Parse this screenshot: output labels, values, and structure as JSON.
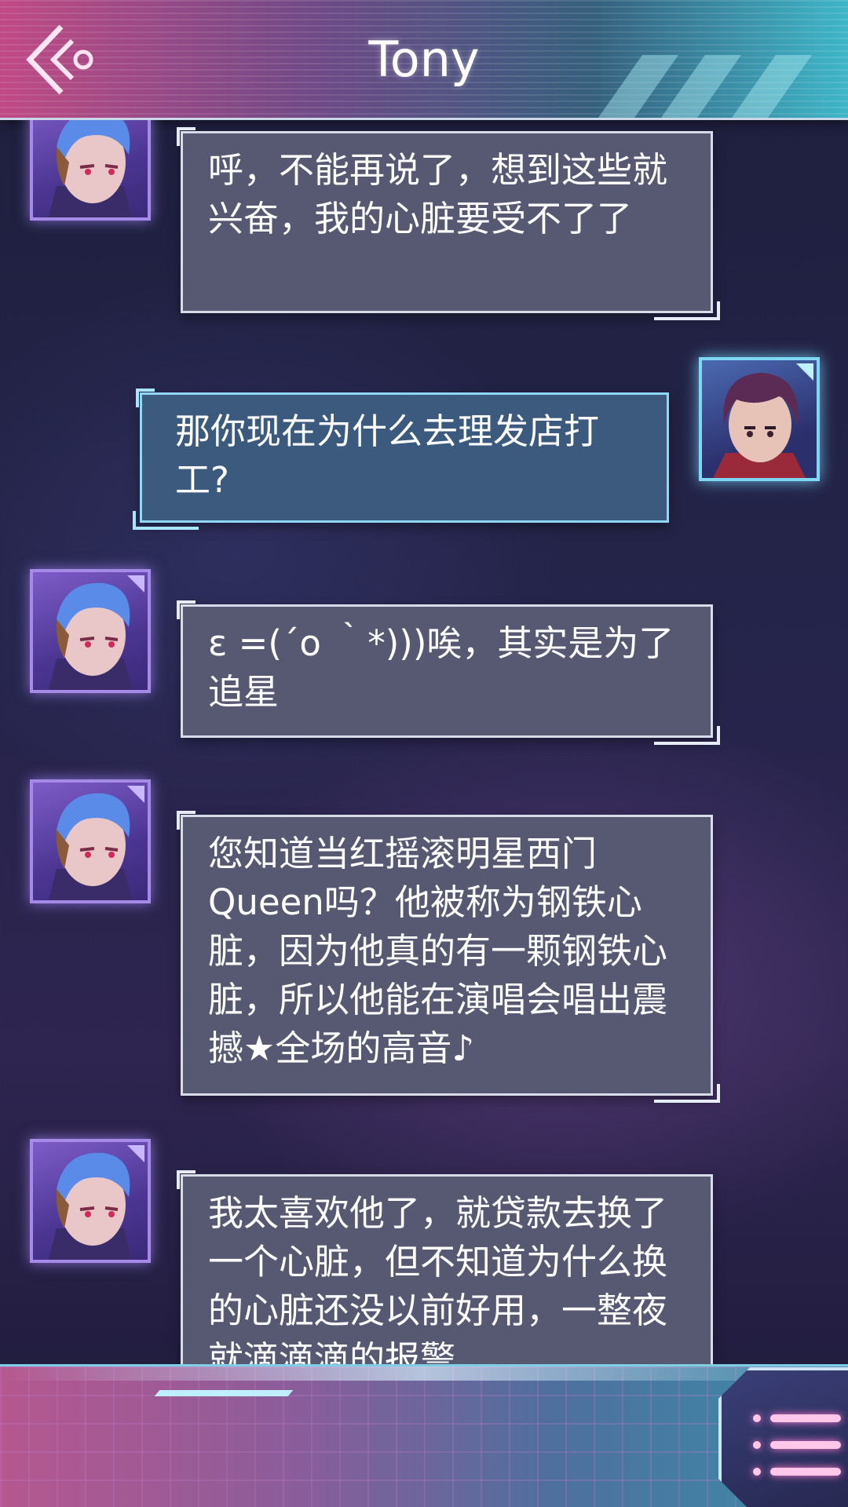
{
  "header": {
    "title": "Tony",
    "back_icon": "back-chevron-icon"
  },
  "messages": [
    {
      "sender": "Tony",
      "side": "left",
      "text": "呼，不能再说了，想到这些就兴奋，我的心脏要受不了了"
    },
    {
      "sender": "player",
      "side": "right",
      "text": "那你现在为什么去理发店打工?"
    },
    {
      "sender": "Tony",
      "side": "left",
      "text": "ε =(´ο ｀*)))唉，其实是为了追星"
    },
    {
      "sender": "Tony",
      "side": "left",
      "text": "您知道当红摇滚明星西门Queen吗？他被称为钢铁心脏，因为他真的有一颗钢铁心脏，所以他能在演唱会唱出震撼★全场的高音♪"
    },
    {
      "sender": "Tony",
      "side": "left",
      "text": "我太喜欢他了，就贷款去换了一个心脏，但不知道为什么换的心脏还没以前好用，一整夜就滴滴滴的报警"
    }
  ],
  "footer": {
    "menu_icon": "menu-list-icon"
  },
  "colors": {
    "header_gradient_start": "#c04a85",
    "header_gradient_end": "#3fb6c8",
    "npc_bubble": "#575972",
    "player_bubble": "#3c5a7e",
    "menu_glow": "#ff7ccf"
  }
}
